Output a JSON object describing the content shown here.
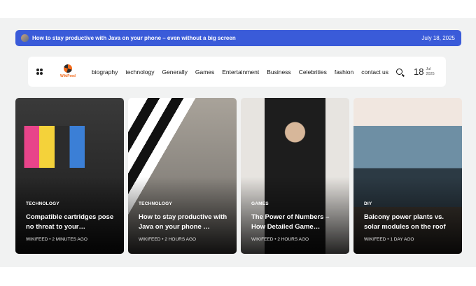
{
  "ticker": {
    "headline": "How to stay productive with Java on your phone – even without a big screen",
    "date": "July 18, 2025"
  },
  "nav": {
    "logo_text": "WikiFeed",
    "menu": [
      "biography",
      "technology",
      "Generally",
      "Games",
      "Entertainment",
      "Business",
      "Celebrities",
      "fashion",
      "contact us"
    ],
    "day": "18",
    "month": "Jul",
    "year": "2025"
  },
  "cards": [
    {
      "category": "TECHNOLOGY",
      "title": "Compatible cartridges pose no threat to your…",
      "author": "WIKIFEED",
      "time": "2 MINUTES AGO"
    },
    {
      "category": "TECHNOLOGY",
      "title": "How to stay productive with Java on your phone …",
      "author": "WIKIFEED",
      "time": "2 HOURS AGO"
    },
    {
      "category": "GAMES",
      "title": "The Power of Numbers – How Detailed Game…",
      "author": "WIKIFEED",
      "time": "2 HOURS AGO"
    },
    {
      "category": "DIY",
      "title": "Balcony power plants vs. solar modules on the roof",
      "author": "WIKIFEED",
      "time": "1 DAY AGO"
    }
  ]
}
